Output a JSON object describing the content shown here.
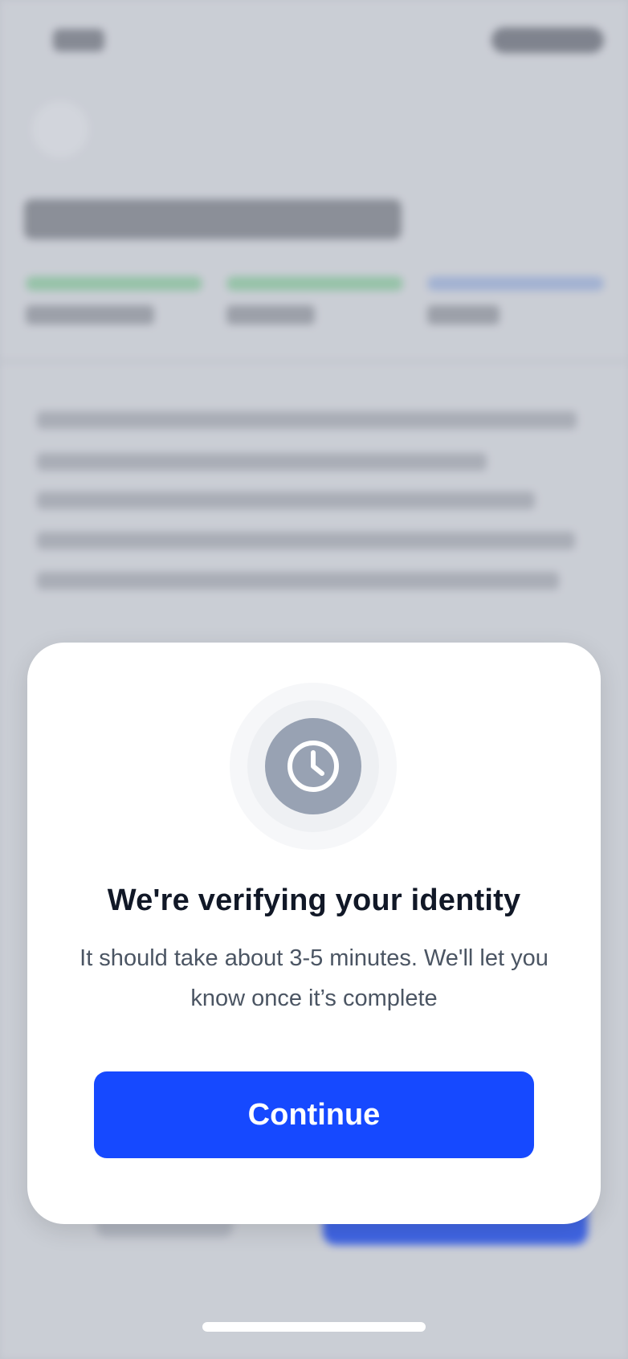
{
  "modal": {
    "title": "We're verifying your identity",
    "body": "It should take about 3-5 minutes. We'll let you know once it’s complete",
    "icon": "clock-icon",
    "continue_label": "Continue"
  },
  "colors": {
    "primary": "#1649ff",
    "icon_bg": "#98a2b3",
    "title": "#111827",
    "body": "#4b5563"
  }
}
